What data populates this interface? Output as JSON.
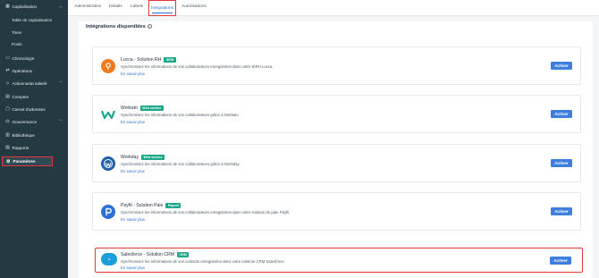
{
  "sidebar": {
    "items": [
      {
        "label": "Capitalisation",
        "icon": "chart-icon",
        "chevron": "⌃"
      },
      {
        "label": "Table de capitalisation"
      },
      {
        "label": "Titres"
      },
      {
        "label": "Pools"
      },
      {
        "label": "Chronologie",
        "icon": "calendar-icon"
      },
      {
        "label": "Opérations",
        "icon": "operations-icon"
      },
      {
        "label": "Actionnariat salarié",
        "icon": "users-icon",
        "chevron": "⌄"
      },
      {
        "label": "Comptes",
        "icon": "accounts-icon"
      },
      {
        "label": "Carnet d'adresses",
        "icon": "addressbook-icon"
      },
      {
        "label": "Gouvernance",
        "icon": "governance-icon",
        "chevron": "⌄"
      },
      {
        "label": "Bibliothèque",
        "icon": "library-icon"
      },
      {
        "label": "Rapports",
        "icon": "reports-icon"
      },
      {
        "label": "Paramètres",
        "icon": "gear-icon"
      }
    ]
  },
  "tabs": [
    {
      "label": "Administration"
    },
    {
      "label": "Détails"
    },
    {
      "label": "Labels"
    },
    {
      "label": "Intégrations"
    },
    {
      "label": "Autorisations"
    }
  ],
  "section": {
    "title": "Intégrations disponibles",
    "info_icon": "info-icon"
  },
  "integrations": [
    {
      "name": "Lucca - Solution RH",
      "badge": "SIRH",
      "desc": "Synchronisez les informations de vos collaborateurs enregistrées dans votre SIRH Lucca.",
      "link": "En savoir plus",
      "button": "Activer",
      "logo_color": "#f07a1e"
    },
    {
      "name": "Workato",
      "badge": "Web service",
      "desc": "Synchronisez les informations de vos collaborateurs grâce à Workato",
      "link": "En savoir plus",
      "button": "Activer",
      "logo_color": "#1aa88a"
    },
    {
      "name": "Workday",
      "badge": "Web service",
      "desc": "Synchronisez les informations de vos collaborateurs grâce à Workday",
      "link": "En savoir plus",
      "button": "Activer",
      "logo_color": "#1f5fb0"
    },
    {
      "name": "Payfit - Solution Paie",
      "badge": "Payroll",
      "desc": "Synchronisez les informations de vos collaborateurs enregistrées dans votre solution de paie Payfit",
      "link": "En savoir plus",
      "button": "Activer",
      "logo_color": "#2a6fd6"
    },
    {
      "name": "Salesforce - Solution CRM",
      "badge": "CRM",
      "desc": "Synchronisez les informations de vos contacts enregistrées dans votre solution CRM Salesforce",
      "link": "En savoir plus",
      "button": "Activer",
      "logo_color": "#1a9fdb"
    }
  ],
  "colors": {
    "accent": "#3d7fe0",
    "badge": "#1aa88a",
    "highlight": "#e23a3a",
    "sidebar": "#233a42"
  }
}
